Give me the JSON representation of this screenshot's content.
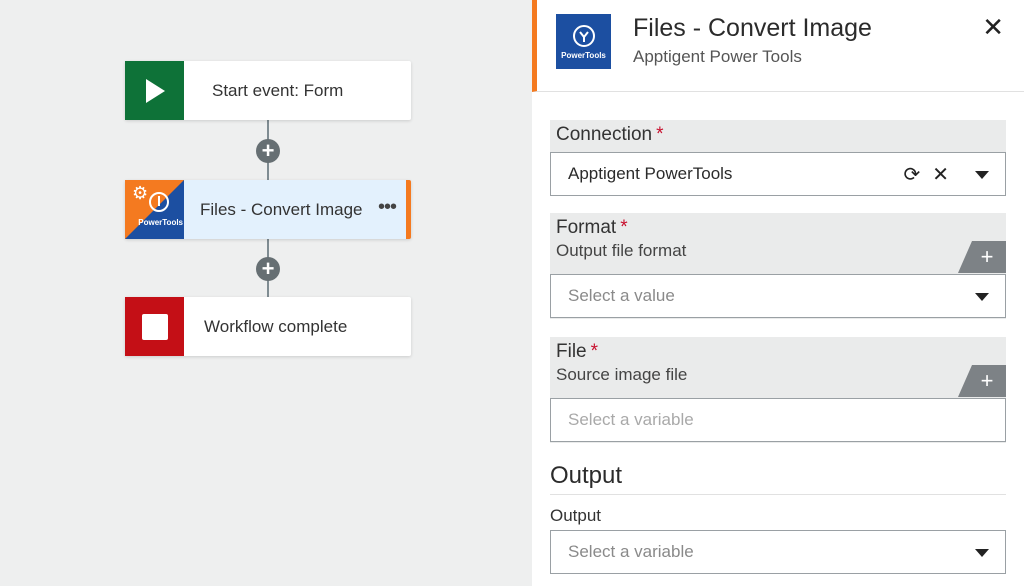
{
  "workflow": {
    "nodes": [
      {
        "label": "Start event: Form",
        "icon": "play-icon",
        "color": "#0e7238"
      },
      {
        "label": "Files - Convert Image",
        "icon": "powertools-icon",
        "icon_text": "PowerTools",
        "color": "#1c4fa1",
        "more": "•••"
      },
      {
        "label": "Workflow complete",
        "icon": "stop-icon",
        "color": "#c40f16"
      }
    ],
    "add_step": "+"
  },
  "panel": {
    "logo_text": "PowerTools",
    "title": "Files - Convert Image",
    "subtitle": "Apptigent Power Tools",
    "close": "✕",
    "accent": "#f47a20",
    "fields": {
      "connection": {
        "label": "Connection",
        "required": "*",
        "value": "Apptigent PowerTools",
        "refresh": "⟳",
        "clear": "✕"
      },
      "format": {
        "label": "Format",
        "required": "*",
        "description": "Output file format",
        "placeholder": "Select a value",
        "insert": "+"
      },
      "file": {
        "label": "File",
        "required": "*",
        "description": "Source image file",
        "placeholder": "Select a variable",
        "insert": "+"
      }
    },
    "output_section": {
      "title": "Output",
      "label": "Output",
      "placeholder": "Select a variable"
    }
  }
}
